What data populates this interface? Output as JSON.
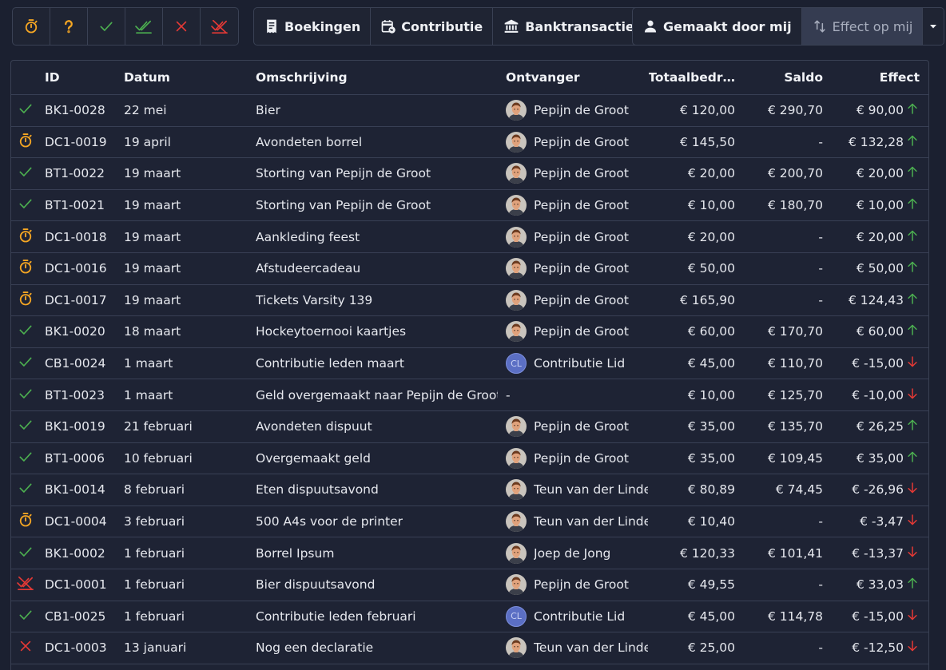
{
  "toolbar": {
    "status_filters": [
      {
        "icon": "stopwatch-icon",
        "color": "#f5a623"
      },
      {
        "icon": "question-mark-icon",
        "color": "#f5a623"
      },
      {
        "icon": "check-icon",
        "color": "#4caf50"
      },
      {
        "icon": "double-check-icon",
        "color": "#4caf50"
      },
      {
        "icon": "close-icon",
        "color": "#e53935"
      },
      {
        "icon": "crossed-double-check-icon",
        "color": "#e53935"
      }
    ],
    "type_filters": [
      {
        "label": "Boekingen",
        "icon": "receipt-icon"
      },
      {
        "label": "Contributie",
        "icon": "calendar-refresh-icon"
      },
      {
        "label": "Banktransacties",
        "icon": "bank-icon"
      }
    ],
    "owner_filters": [
      {
        "label": "Gemaakt door mij",
        "icon": "person-icon"
      },
      {
        "label": "Effect op mij",
        "icon": "swap-vertical-icon"
      }
    ],
    "dropdown_icon": "caret-down-icon"
  },
  "table": {
    "columns": [
      "ID",
      "Datum",
      "Omschrijving",
      "Ontvanger",
      "Totaalbedr…",
      "Saldo",
      "Effect"
    ],
    "status_colors": {
      "approved": "#4caf50",
      "pending": "#f5a623",
      "rejected": "#e53935"
    },
    "effect_colors": {
      "up": "#4caf50",
      "down": "#e53935"
    },
    "rows": [
      {
        "status": "approved",
        "status_icon": "check-icon",
        "id": "BK1-0028",
        "date": "22 mei",
        "description": "Bier",
        "recipient": "Pepijn de Groot",
        "avatar": "photo",
        "total": "€ 120,00",
        "balance": "€ 290,70",
        "effect": "€ 90,00",
        "direction": "up"
      },
      {
        "status": "pending",
        "status_icon": "stopwatch-icon",
        "id": "DC1-0019",
        "date": "19 april",
        "description": "Avondeten borrel",
        "recipient": "Pepijn de Groot",
        "avatar": "photo",
        "total": "€ 145,50",
        "balance": "-",
        "effect": "€ 132,28",
        "direction": "up"
      },
      {
        "status": "approved",
        "status_icon": "check-icon",
        "id": "BT1-0022",
        "date": "19 maart",
        "description": "Storting van Pepijn de Groot",
        "recipient": "Pepijn de Groot",
        "avatar": "photo",
        "total": "€ 20,00",
        "balance": "€ 200,70",
        "effect": "€ 20,00",
        "direction": "up"
      },
      {
        "status": "approved",
        "status_icon": "check-icon",
        "id": "BT1-0021",
        "date": "19 maart",
        "description": "Storting van Pepijn de Groot",
        "recipient": "Pepijn de Groot",
        "avatar": "photo",
        "total": "€ 10,00",
        "balance": "€ 180,70",
        "effect": "€ 10,00",
        "direction": "up"
      },
      {
        "status": "pending",
        "status_icon": "stopwatch-icon",
        "id": "DC1-0018",
        "date": "19 maart",
        "description": "Aankleding feest",
        "recipient": "Pepijn de Groot",
        "avatar": "photo",
        "total": "€ 20,00",
        "balance": "-",
        "effect": "€ 20,00",
        "direction": "up"
      },
      {
        "status": "pending",
        "status_icon": "stopwatch-icon",
        "id": "DC1-0016",
        "date": "19 maart",
        "description": "Afstudeercadeau",
        "recipient": "Pepijn de Groot",
        "avatar": "photo",
        "total": "€ 50,00",
        "balance": "-",
        "effect": "€ 50,00",
        "direction": "up"
      },
      {
        "status": "pending",
        "status_icon": "stopwatch-icon",
        "id": "DC1-0017",
        "date": "19 maart",
        "description": "Tickets Varsity 139",
        "recipient": "Pepijn de Groot",
        "avatar": "photo",
        "total": "€ 165,90",
        "balance": "-",
        "effect": "€ 124,43",
        "direction": "up"
      },
      {
        "status": "approved",
        "status_icon": "check-icon",
        "id": "BK1-0020",
        "date": "18 maart",
        "description": "Hockeytoernooi kaartjes",
        "recipient": "Pepijn de Groot",
        "avatar": "photo",
        "total": "€ 60,00",
        "balance": "€ 170,70",
        "effect": "€ 60,00",
        "direction": "up"
      },
      {
        "status": "approved",
        "status_icon": "check-icon",
        "id": "CB1-0024",
        "date": "1 maart",
        "description": "Contributie leden maart",
        "recipient": "Contributie Lid",
        "avatar": "initials",
        "initials": "CL",
        "total": "€ 45,00",
        "balance": "€ 110,70",
        "effect": "€ -15,00",
        "direction": "down"
      },
      {
        "status": "approved",
        "status_icon": "check-icon",
        "id": "BT1-0023",
        "date": "1 maart",
        "description": "Geld overgemaakt naar Pepijn de Groot",
        "recipient": "-",
        "avatar": "none",
        "total": "€ 10,00",
        "balance": "€ 125,70",
        "effect": "€ -10,00",
        "direction": "down"
      },
      {
        "status": "approved",
        "status_icon": "check-icon",
        "id": "BK1-0019",
        "date": "21 februari",
        "description": "Avondeten dispuut",
        "recipient": "Pepijn de Groot",
        "avatar": "photo",
        "total": "€ 35,00",
        "balance": "€ 135,70",
        "effect": "€ 26,25",
        "direction": "up"
      },
      {
        "status": "approved",
        "status_icon": "check-icon",
        "id": "BT1-0006",
        "date": "10 februari",
        "description": "Overgemaakt geld",
        "recipient": "Pepijn de Groot",
        "avatar": "photo",
        "total": "€ 35,00",
        "balance": "€ 109,45",
        "effect": "€ 35,00",
        "direction": "up"
      },
      {
        "status": "approved",
        "status_icon": "check-icon",
        "id": "BK1-0014",
        "date": "8 februari",
        "description": "Eten dispuutsavond",
        "recipient": "Teun van der Linde",
        "avatar": "photo",
        "total": "€ 80,89",
        "balance": "€ 74,45",
        "effect": "€ -26,96",
        "direction": "down"
      },
      {
        "status": "pending",
        "status_icon": "stopwatch-icon",
        "id": "DC1-0004",
        "date": "3 februari",
        "description": "500 A4s voor de printer",
        "recipient": "Teun van der Linde",
        "avatar": "photo",
        "total": "€ 10,40",
        "balance": "-",
        "effect": "€ -3,47",
        "direction": "down"
      },
      {
        "status": "approved",
        "status_icon": "check-icon",
        "id": "BK1-0002",
        "date": "1 februari",
        "description": "Borrel Ipsum",
        "recipient": "Joep de Jong",
        "avatar": "photo",
        "total": "€ 120,33",
        "balance": "€ 101,41",
        "effect": "€ -13,37",
        "direction": "down"
      },
      {
        "status": "rejected",
        "status_icon": "crossed-double-check-icon",
        "id": "DC1-0001",
        "date": "1 februari",
        "description": "Bier dispuutsavond",
        "recipient": "Pepijn de Groot",
        "avatar": "photo",
        "total": "€ 49,55",
        "balance": "-",
        "effect": "€ 33,03",
        "direction": "up"
      },
      {
        "status": "approved",
        "status_icon": "check-icon",
        "id": "CB1-0025",
        "date": "1 februari",
        "description": "Contributie leden februari",
        "recipient": "Contributie Lid",
        "avatar": "initials",
        "initials": "CL",
        "total": "€ 45,00",
        "balance": "€ 114,78",
        "effect": "€ -15,00",
        "direction": "down"
      },
      {
        "status": "rejected",
        "status_icon": "close-icon",
        "id": "DC1-0003",
        "date": "13 januari",
        "description": "Nog een declaratie",
        "recipient": "Teun van der Linde",
        "avatar": "photo",
        "total": "€ 25,00",
        "balance": "-",
        "effect": "€ -12,50",
        "direction": "down"
      }
    ]
  }
}
